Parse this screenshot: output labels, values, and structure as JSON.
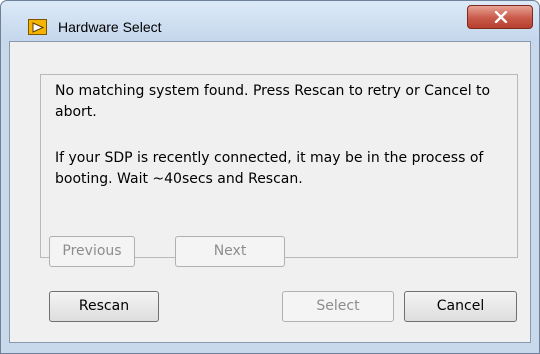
{
  "window": {
    "title": "Hardware Select",
    "icon": "labview-app-icon",
    "close_icon": "close-icon"
  },
  "message": {
    "line1": "No matching system found. Press Rescan to retry or Cancel to abort.",
    "line2": "If your SDP is recently connected, it may be in the process of booting. Wait ~40secs and Rescan."
  },
  "buttons": {
    "previous": "Previous",
    "next": "Next",
    "rescan": "Rescan",
    "select": "Select",
    "cancel": "Cancel"
  },
  "colors": {
    "close_button": "#c9594a",
    "disabled_text": "#8d8d8d"
  }
}
